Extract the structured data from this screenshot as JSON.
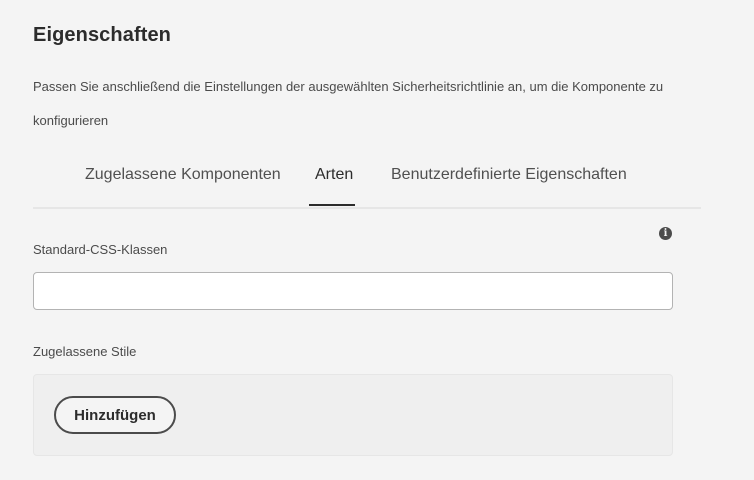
{
  "header": {
    "title": "Eigenschaften",
    "description": "Passen Sie anschließend die Einstellungen der ausgewählten Sicherheitsrichtlinie an, um die Komponente zu konfigurieren"
  },
  "tabs": [
    {
      "label": "Zugelassene Komponenten",
      "active": false
    },
    {
      "label": "Arten",
      "active": true
    },
    {
      "label": "Benutzerdefinierte Eigenschaften",
      "active": false
    }
  ],
  "form": {
    "css_classes_label": "Standard-CSS-Klassen",
    "css_classes_value": "",
    "info_icon": "info-icon",
    "allowed_styles_label": "Zugelassene Stile",
    "add_button_label": "Hinzufügen"
  },
  "colors": {
    "background": "#f4f4f4",
    "text": "#2c2c2c",
    "active_tab_indicator": "#2c2c2c",
    "input_border": "#b3b3b3"
  }
}
